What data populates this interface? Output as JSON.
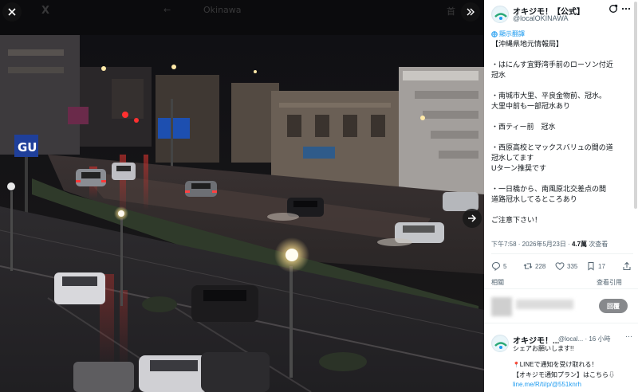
{
  "viewer": {
    "close_label": "×",
    "ghost_home": "X",
    "ghost_back": "←",
    "ghost_title": "Okinawa",
    "ghost_right": "首",
    "expand_label": "»",
    "next_label": "→"
  },
  "tweet": {
    "author_name": "オキジモ！【公式】",
    "author_handle": "@localOKINAWA",
    "translate": "顯示翻譯",
    "body": [
      "【沖縄県地元情報局】",
      "・はにんす宜野湾手前のローソン付近\n冠水",
      "・南城市大里、平良金物前、冠水。\n大里中前も一部冠水あり",
      "・西ティー前　冠水",
      "・西原高校とマックスバリュの間の道\n冠水してます\nUターン推奨です",
      "・一日橋から、南風原北交差点の間\n道路冠水してるところあり",
      "ご注意下さい！"
    ],
    "time": "下午7:58 · 2026年5月23日 · ",
    "views_count": "4.7萬",
    "views_label": " 次查看",
    "stats": {
      "replies": "5",
      "retweets": "228",
      "likes": "335",
      "bookmarks": "17"
    },
    "related_label": "相關",
    "view_quotes": "查看引用",
    "reply_button": "回覆"
  },
  "reply": {
    "name": "オキジモ！...",
    "handle": "@local... · 16 小時",
    "more": "···",
    "line1": "シェアお願いします!!",
    "line2": "LINEで通知を受け取れる！",
    "line3": "【オキジモ通知プラン】はこちら⇩",
    "link": "line.me/R/ti/p/@551knrh"
  },
  "colors": {
    "accent": "#1d9bf0",
    "text": "#0f1419",
    "secondary": "#536471"
  },
  "icons": [
    "close-icon",
    "expand-icon",
    "next-arrow-icon",
    "grok-icon",
    "more-icon",
    "translate-icon",
    "reply-icon",
    "retweet-icon",
    "like-icon",
    "bookmark-icon",
    "share-icon"
  ]
}
